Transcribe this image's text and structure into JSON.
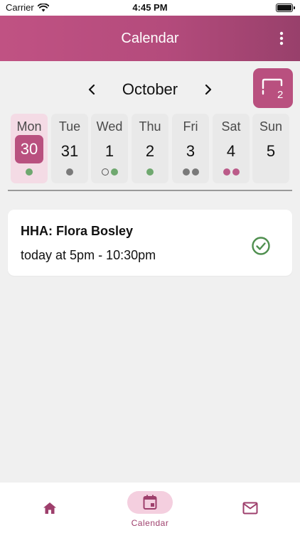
{
  "status_bar": {
    "carrier": "Carrier",
    "time": "4:45 PM"
  },
  "app_bar": {
    "title": "Calendar",
    "menu_icon": "more-vertical-icon"
  },
  "month_nav": {
    "month": "October",
    "view_badge": "2"
  },
  "week": [
    {
      "name": "Mon",
      "num": "30",
      "selected": true,
      "dots": [
        "green"
      ]
    },
    {
      "name": "Tue",
      "num": "31",
      "selected": false,
      "dots": [
        "gray"
      ]
    },
    {
      "name": "Wed",
      "num": "1",
      "selected": false,
      "dots": [
        "hollow",
        "green"
      ]
    },
    {
      "name": "Thu",
      "num": "2",
      "selected": false,
      "dots": [
        "green"
      ]
    },
    {
      "name": "Fri",
      "num": "3",
      "selected": false,
      "dots": [
        "gray",
        "gray"
      ]
    },
    {
      "name": "Sat",
      "num": "4",
      "selected": false,
      "dots": [
        "pink",
        "pink"
      ]
    },
    {
      "name": "Sun",
      "num": "5",
      "selected": false,
      "dots": []
    }
  ],
  "visits": [
    {
      "title": "HHA: Flora Bosley",
      "time": "today at 5pm - 10:30pm",
      "status_icon": "check-circle-icon"
    }
  ],
  "bottom_nav": {
    "home_icon": "home-icon",
    "calendar_label": "Calendar",
    "calendar_icon": "calendar-icon",
    "messages_icon": "mail-icon"
  },
  "colors": {
    "accent": "#b9507f",
    "selected_bg": "#f4dbe5",
    "dot_green": "#6fa86f",
    "dot_gray": "#7a7a7a",
    "dot_pink": "#bb5b89",
    "check_green": "#4f8f4f"
  }
}
